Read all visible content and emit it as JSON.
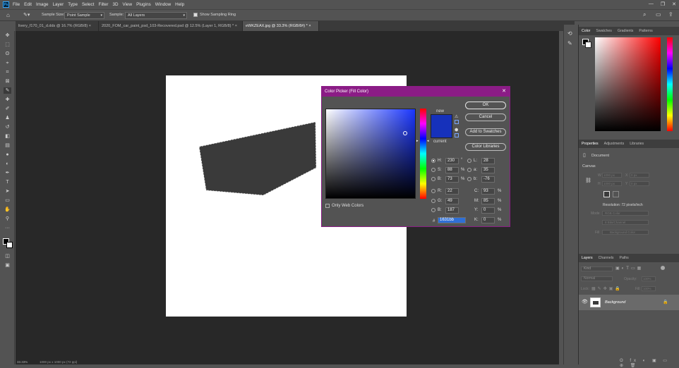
{
  "menubar": {
    "logo": "Ps",
    "items": [
      "File",
      "Edit",
      "Image",
      "Layer",
      "Type",
      "Select",
      "Filter",
      "3D",
      "View",
      "Plugins",
      "Window",
      "Help"
    ],
    "window_controls": [
      "—",
      "❐",
      "✕"
    ]
  },
  "options": {
    "sample_size_label": "Sample Size:",
    "sample_size_value": "Point Sample",
    "sample_label": "Sample:",
    "sample_value": "All Layers",
    "show_ring_label": "Show Sampling Ring"
  },
  "tabs": [
    {
      "label": "livery_f170_01_d.dds @ 16.7% (RGB/8)",
      "active": false
    },
    {
      "label": "2020_FOM_car_paint_psd_103-Recovered.psd @ 12.5% (Layer 1, RGB/8) *",
      "active": false
    },
    {
      "label": "eWKZEAX.jpg @ 33.3% (RGB/8#) *",
      "active": true
    }
  ],
  "tools": [
    "move-tool-icon",
    "marquee-tool-icon",
    "lasso-tool-icon",
    "quick-select-icon",
    "crop-tool-icon",
    "frame-tool-icon",
    "eyedropper-tool-icon",
    "healing-brush-icon",
    "brush-tool-icon",
    "clone-stamp-icon",
    "history-brush-icon",
    "eraser-tool-icon",
    "gradient-tool-icon",
    "blur-tool-icon",
    "dodge-tool-icon",
    "pen-tool-icon",
    "type-tool-icon",
    "path-select-icon",
    "rectangle-tool-icon",
    "hand-tool-icon",
    "zoom-tool-icon",
    "more-tools-icon"
  ],
  "colors": {
    "accent": "#8b1c86",
    "new_color": "#1631bb",
    "current_color": "#1631bb",
    "shape": "#3a3a3a"
  },
  "dialog": {
    "title": "Color Picker (Fill Color)",
    "ok": "OK",
    "cancel": "Cancel",
    "add_swatches": "Add to Swatches",
    "color_libraries": "Color Libraries",
    "new_label": "new",
    "current_label": "current",
    "web_only": "Only Web Colors",
    "h_label": "H:",
    "h_value": "230",
    "h_unit": "°",
    "s_label": "S:",
    "s_value": "88",
    "s_unit": "%",
    "b_label": "B:",
    "b_value": "73",
    "b_unit": "%",
    "r_label": "R:",
    "r_value": "22",
    "g_label": "G:",
    "g_value": "49",
    "bb_label": "B:",
    "bb_value": "187",
    "l_label": "L:",
    "l_value": "28",
    "a_label": "a:",
    "a_value": "35",
    "lb_label": "b:",
    "lb_value": "-76",
    "c_label": "C:",
    "c_value": "93",
    "m_label": "M:",
    "m_value": "85",
    "y_label": "Y:",
    "y_value": "0",
    "k_label": "K:",
    "k_value": "0",
    "pct": "%",
    "hex_label": "#",
    "hex_value": "1631bb"
  },
  "color_panel": {
    "tabs": [
      "Color",
      "Swatches",
      "Gradients",
      "Patterns"
    ]
  },
  "properties": {
    "tabs": [
      "Properties",
      "Adjustments",
      "Libraries"
    ],
    "type": "Document",
    "section": "Canvas",
    "w_label": "W",
    "w_value": "1000 px",
    "h_label": "H",
    "h_value": "1000 px",
    "x_label": "X",
    "x_value": "0 px",
    "y_label": "Y",
    "y_value": "0 px",
    "resolution": "Resolution: 72 pixels/inch",
    "mode_label": "Mode",
    "mode_value": "RGB Color",
    "depth_value": "8 Bits/Channel",
    "fill_label": "Fill",
    "fill_value": "Background Color"
  },
  "layers": {
    "tabs": [
      "Layers",
      "Channels",
      "Paths"
    ],
    "search_placeholder": "Kind",
    "blend_mode": "Normal",
    "opacity_label": "Opacity:",
    "opacity_value": "100%",
    "lock_label": "Lock:",
    "fill_label": "Fill:",
    "fill_value": "100%",
    "layer_name": "Background"
  },
  "status": {
    "zoom": "33.33%",
    "info": "1000 px x 1000 px (72 ppi)"
  }
}
